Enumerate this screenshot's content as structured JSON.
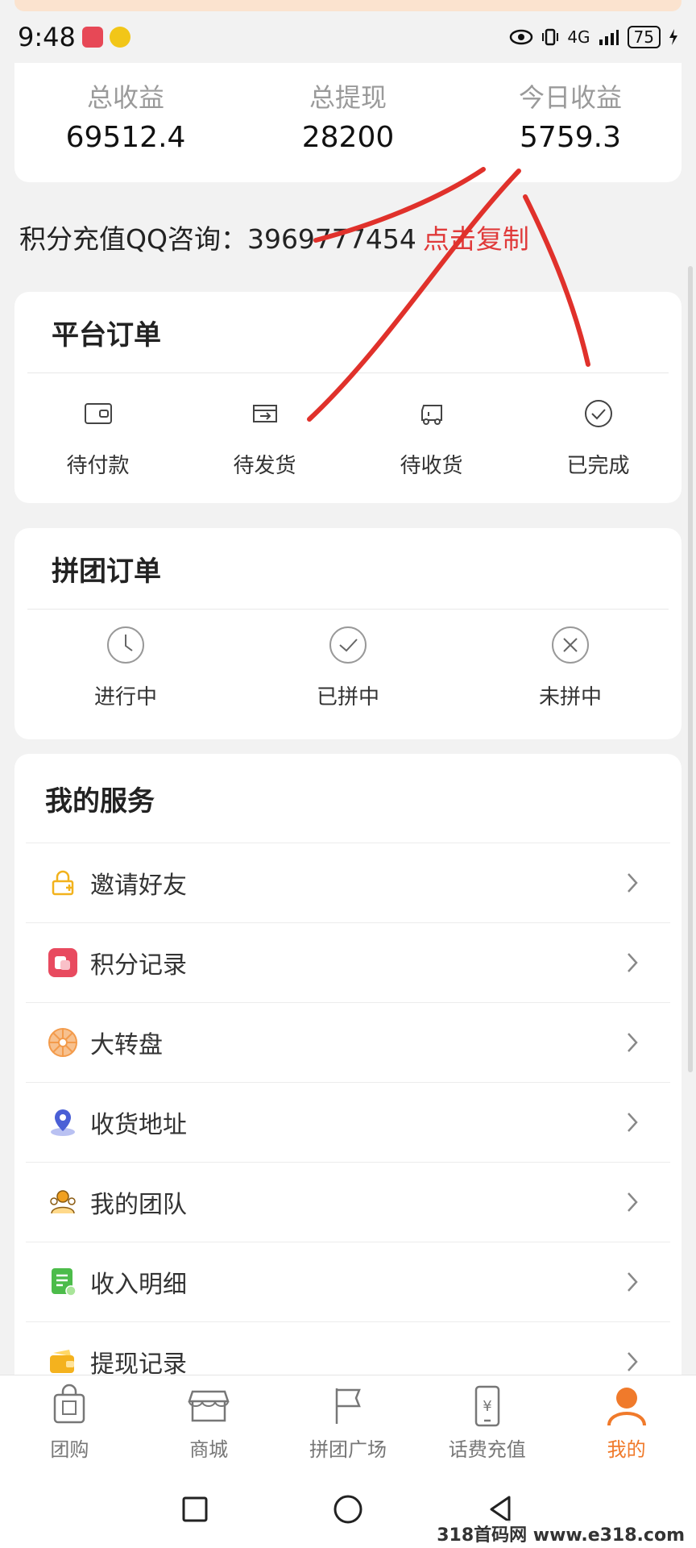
{
  "status_bar": {
    "time": "9:48",
    "network": "4G",
    "battery": "75"
  },
  "stats": [
    {
      "label": "总收益",
      "value": "69512.4"
    },
    {
      "label": "总提现",
      "value": "28200"
    },
    {
      "label": "今日收益",
      "value": "5759.3"
    }
  ],
  "qq_consult": {
    "text": "积分充值QQ咨询：3969777454",
    "copy_label": "点击复制"
  },
  "platform_orders": {
    "title": "平台订单",
    "items": [
      {
        "label": "待付款",
        "icon": "wallet-icon"
      },
      {
        "label": "待发货",
        "icon": "ship-out-icon"
      },
      {
        "label": "待收货",
        "icon": "truck-icon"
      },
      {
        "label": "已完成",
        "icon": "check-circle-icon"
      }
    ]
  },
  "group_orders": {
    "title": "拼团订单",
    "items": [
      {
        "label": "进行中",
        "icon": "clock-icon"
      },
      {
        "label": "已拼中",
        "icon": "check-circle-icon"
      },
      {
        "label": "未拼中",
        "icon": "x-circle-icon"
      }
    ]
  },
  "services": {
    "title": "我的服务",
    "items": [
      {
        "label": "邀请好友",
        "icon": "invite-lock-icon",
        "color": "#f2b21c"
      },
      {
        "label": "积分记录",
        "icon": "points-record-icon",
        "color": "#e84a5f"
      },
      {
        "label": "大转盘",
        "icon": "wheel-icon",
        "color": "#f39b4b"
      },
      {
        "label": "收货地址",
        "icon": "location-pin-icon",
        "color": "#4a5fd6"
      },
      {
        "label": "我的团队",
        "icon": "team-icon",
        "color": "#f0a020"
      },
      {
        "label": "收入明细",
        "icon": "income-doc-icon",
        "color": "#4cbc4a"
      },
      {
        "label": "提现记录",
        "icon": "withdraw-icon",
        "color": "#f4b21e"
      }
    ]
  },
  "tabbar": {
    "items": [
      {
        "label": "团购",
        "icon": "group-buy-icon"
      },
      {
        "label": "商城",
        "icon": "shop-icon"
      },
      {
        "label": "拼团广场",
        "icon": "flag-icon"
      },
      {
        "label": "话费充值",
        "icon": "phone-recharge-icon"
      },
      {
        "label": "我的",
        "icon": "user-icon",
        "active": true
      }
    ],
    "active_color": "#f07a2b"
  },
  "watermark": "318首码网 www.e318.com"
}
